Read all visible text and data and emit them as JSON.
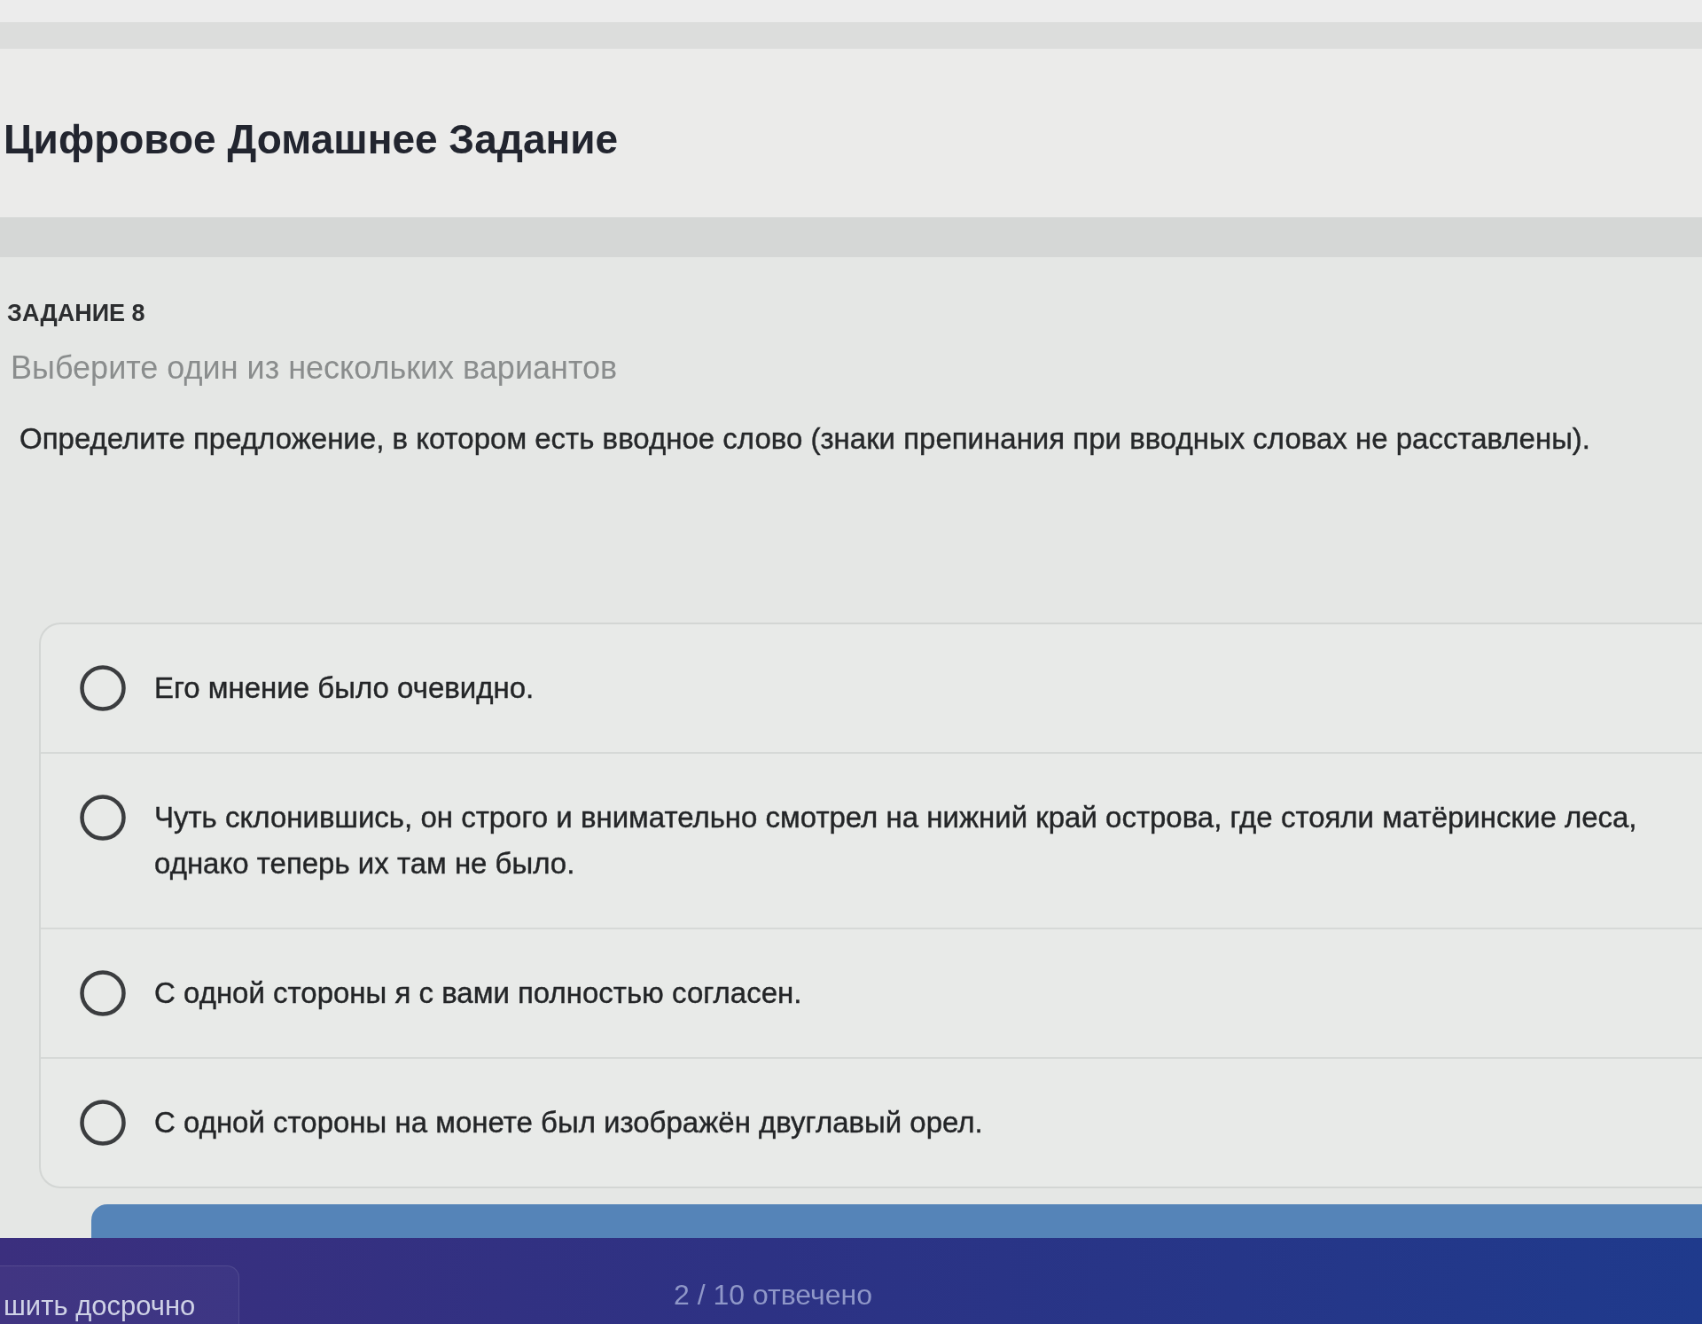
{
  "header": {
    "title": "Цифровое Домашнее Задание"
  },
  "task": {
    "number_label": "ЗАДАНИЕ 8",
    "instruction": "Выберите один из нескольких вариантов",
    "question": "Определите предложение, в котором есть вводное слово (знаки препинания при вводных словах не расставлены).",
    "options": [
      {
        "text": "Его мнение было очевидно.",
        "selected": false
      },
      {
        "text": "Чуть склонившись, он строго и внимательно смотрел на нижний край острова, где стояли матёринские леса, однако теперь их там не было.",
        "selected": false
      },
      {
        "text": "С одной стороны я с вами полностью согласен.",
        "selected": false
      },
      {
        "text": "С одной стороны на монете был изображён двуглавый орел.",
        "selected": false
      }
    ]
  },
  "footer": {
    "finish_button": "шить досрочно",
    "progress": "2 / 10 отвечено"
  }
}
